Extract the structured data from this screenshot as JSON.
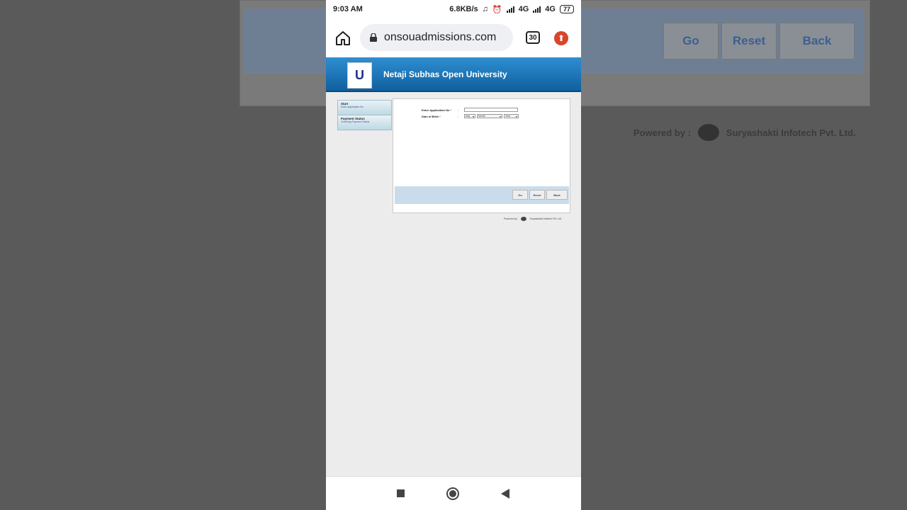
{
  "background": {
    "buttons": [
      "Go",
      "Reset",
      "Back"
    ],
    "powered_by": "Powered by :",
    "company": "Suryashakti Infotech Pvt. Ltd."
  },
  "status_bar": {
    "time": "9:03 AM",
    "speed": "6.8KB/s",
    "network1": "4G",
    "network2": "4G",
    "battery": "77"
  },
  "browser": {
    "url": "onsouadmissions.com",
    "tab_count": "30"
  },
  "site": {
    "title": "Netaji Subhas Open University",
    "logo_text": "U"
  },
  "sidebar": {
    "items": [
      {
        "title": "Start",
        "subtitle": "Enter Application No"
      },
      {
        "title": "Payment Status",
        "subtitle": "Checking Payment Status"
      }
    ]
  },
  "form": {
    "app_no_label": "Enter Application No",
    "dob_label": "Date of Birth",
    "colon": ":",
    "required_mark": "*",
    "day": "Day",
    "month": "Month",
    "year": "Year",
    "go": "Go",
    "reset": "Reset",
    "back": "Back"
  },
  "footer": {
    "powered_by": "Powered by :",
    "company": "Suryashakti Infotech Pvt. Ltd."
  },
  "colors": {
    "header_blue": "#1a73b8",
    "accent_red": "#d9452b"
  }
}
